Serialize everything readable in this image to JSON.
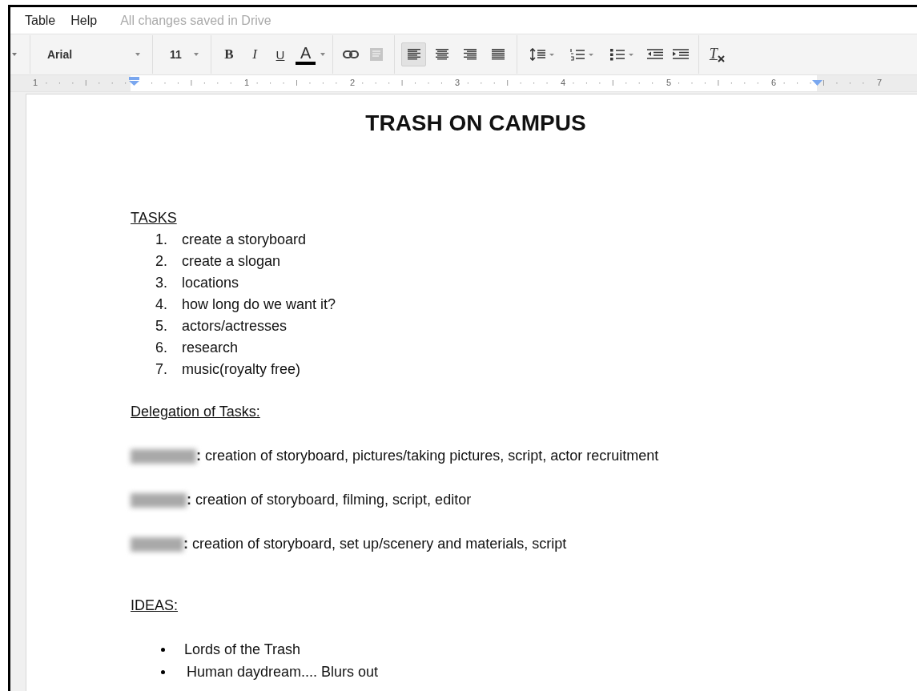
{
  "menu": [
    {
      "label": "Table"
    },
    {
      "label": "Help"
    }
  ],
  "save_status": "All changes saved in Drive",
  "toolbar": {
    "font": "Arial",
    "size": "11",
    "format_buttons": [
      {
        "kind": "bold",
        "label": "B"
      },
      {
        "kind": "italic",
        "label": "I"
      },
      {
        "kind": "underline",
        "label": "U"
      },
      {
        "kind": "color",
        "label": "A",
        "color": "#000000"
      }
    ],
    "insert_buttons": [
      {
        "kind": "link",
        "disabled": false
      },
      {
        "kind": "comment",
        "disabled": true
      }
    ],
    "align_buttons": [
      {
        "kind": "left",
        "selected": true
      },
      {
        "kind": "center",
        "selected": false
      },
      {
        "kind": "right",
        "selected": false
      },
      {
        "kind": "justify",
        "selected": false
      }
    ],
    "list_buttons": [
      {
        "kind": "spacing"
      },
      {
        "kind": "numbered"
      },
      {
        "kind": "bulleted"
      },
      {
        "kind": "outdent"
      },
      {
        "kind": "indent"
      }
    ],
    "clear_label": "T"
  },
  "ruler": {
    "labels": [
      "1",
      "1",
      "2",
      "3",
      "4",
      "5",
      "6",
      "7"
    ]
  },
  "document": {
    "title": "TRASH ON CAMPUS",
    "sections": [
      {
        "kind": "numbered",
        "heading": "TASKS",
        "items": [
          {
            "number": "1.",
            "text": "create a storyboard"
          },
          {
            "number": "2.",
            "text": "create a slogan"
          },
          {
            "number": "3.",
            "text": "locations"
          },
          {
            "number": "4.",
            "text": "how long do we want it?"
          },
          {
            "number": "5.",
            "text": "actors/actresses"
          },
          {
            "number": "6.",
            "text": "research"
          },
          {
            "number": "7.",
            "text": "music(royalty free)"
          }
        ]
      },
      {
        "kind": "assignments",
        "heading": "Delegation of Tasks:",
        "items": [
          {
            "text": "**:** creation of storyboard, pictures/taking pictures, script, actor recruitment"
          },
          {
            "text": "**:** creation of storyboard, filming, script, editor"
          },
          {
            "text": "**:** creation of storyboard, set up/scenery and materials, script"
          }
        ]
      },
      {
        "kind": "bullets",
        "heading": "IDEAS:",
        "items": [
          {
            "text": "Lords of the Trash"
          },
          {
            "text": "Human daydream.... Blurs out"
          }
        ]
      }
    ]
  }
}
